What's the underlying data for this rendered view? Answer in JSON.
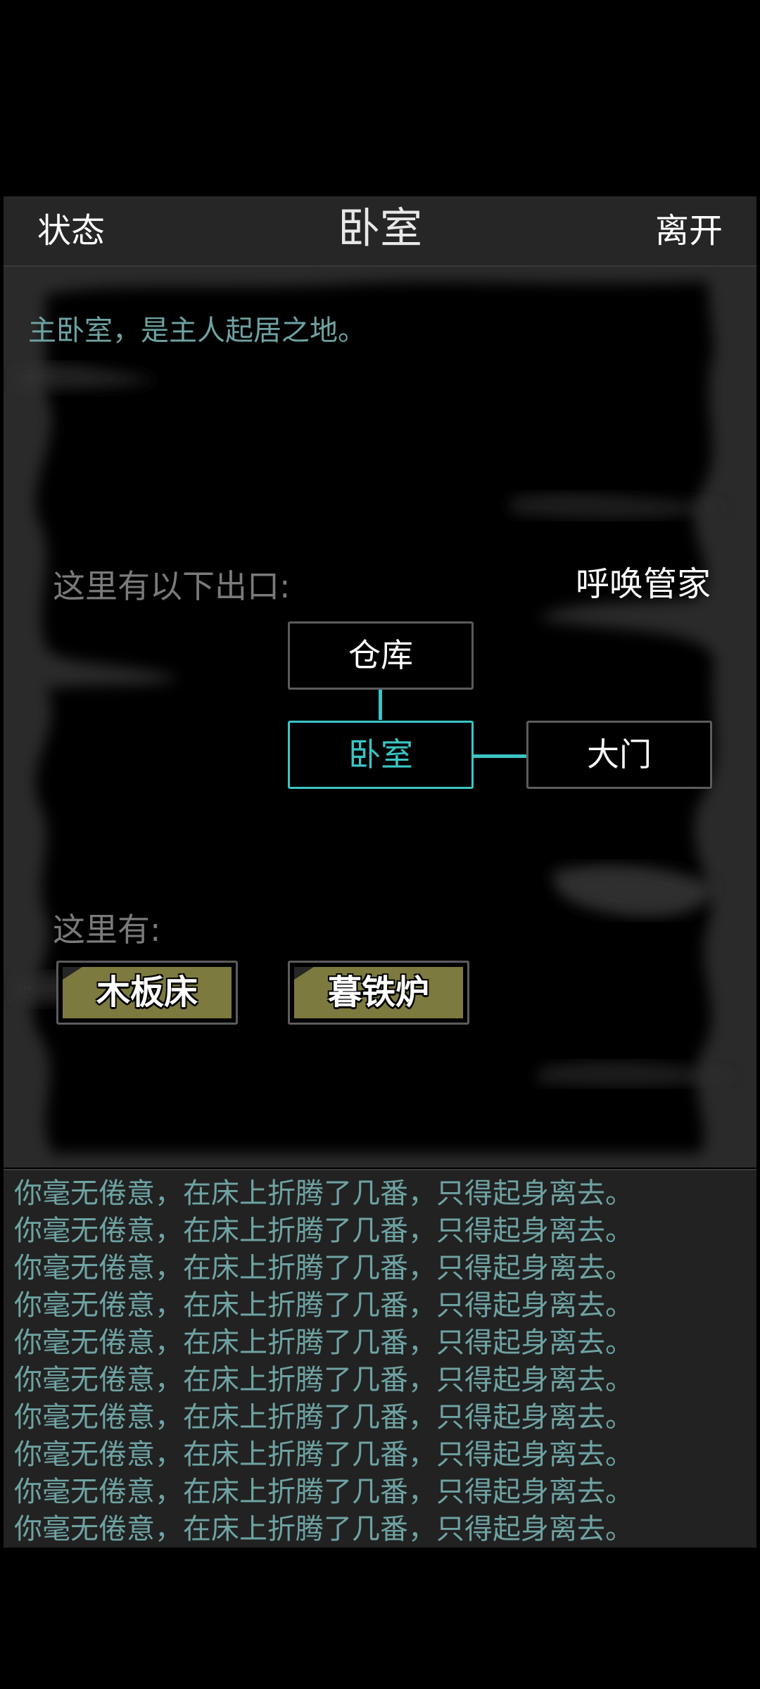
{
  "header": {
    "status_label": "状态",
    "title": "卧室",
    "leave_label": "离开"
  },
  "scene": {
    "description": "主卧室，是主人起居之地。",
    "exits_label": "这里有以下出口:",
    "summon_label": "呼唤管家",
    "map": {
      "north": "仓库",
      "current": "卧室",
      "east": "大门"
    },
    "here_label": "这里有:",
    "items": [
      "木板床",
      "暮铁炉"
    ]
  },
  "log": {
    "lines": [
      "你毫无倦意，在床上折腾了几番，只得起身离去。",
      "你毫无倦意，在床上折腾了几番，只得起身离去。",
      "你毫无倦意，在床上折腾了几番，只得起身离去。",
      "你毫无倦意，在床上折腾了几番，只得起身离去。",
      "你毫无倦意，在床上折腾了几番，只得起身离去。",
      "你毫无倦意，在床上折腾了几番，只得起身离去。",
      "你毫无倦意，在床上折腾了几番，只得起身离去。",
      "你毫无倦意，在床上折腾了几番，只得起身离去。",
      "你毫无倦意，在床上折腾了几番，只得起身离去。",
      "你毫无倦意，在床上折腾了几番，只得起身离去。"
    ]
  },
  "colors": {
    "accent": "#3cc4c4",
    "text_teal": "#6fa3a3",
    "item_fill": "#7d7a3f",
    "panel": "#262626"
  }
}
